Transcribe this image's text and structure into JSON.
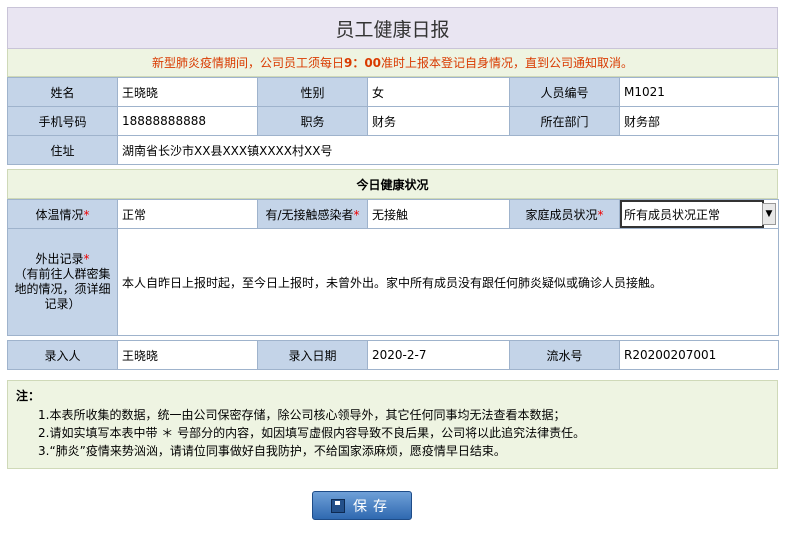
{
  "title": "员工健康日报",
  "notice": {
    "before": "新型肺炎疫情期间，公司员工须每日",
    "time": "9：00",
    "after": "准时上报本登记自身情况，直到公司通知取消。"
  },
  "basic": {
    "name_label": "姓名",
    "name": "王晓晓",
    "gender_label": "性别",
    "gender": "女",
    "empno_label": "人员编号",
    "empno": "M1021",
    "phone_label": "手机号码",
    "phone": "18888888888",
    "position_label": "职务",
    "position": "财务",
    "dept_label": "所在部门",
    "dept": "财务部",
    "address_label": "住址",
    "address": "湖南省长沙市XX县XXX镇XXXX村XX号"
  },
  "health": {
    "section_title": "今日健康状况",
    "temp_label": "体温情况",
    "temp": "正常",
    "contact_label": "有/无接触感染者",
    "contact": "无接触",
    "family_label": "家庭成员状况",
    "family": "所有成员状况正常",
    "outing_label": "外出记录",
    "outing_hint": "（有前往人群密集地的情况，须详细记录）",
    "outing": "本人自昨日上报时起，至今日上报时，未曾外出。家中所有成员没有跟任何肺炎疑似或确诊人员接触。"
  },
  "record": {
    "entry_label": "录入人",
    "entry": "王晓晓",
    "date_label": "录入日期",
    "date": "2020-2-7",
    "serial_label": "流水号",
    "serial": "R20200207001"
  },
  "notes": {
    "heading": "注：",
    "items": [
      "1.本表所收集的数据，统一由公司保密存储，除公司核心领导外，其它任何同事均无法查看本数据；",
      "2.请如实填写本表中带 ＊ 号部分的内容，如因填写虚假内容导致不良后果，公司将以此追究法律责任。",
      "3.“肺炎”疫情来势汹汹，请请位同事做好自我防护，不给国家添麻烦，愿疫情早日结束。"
    ]
  },
  "required_mark": "*",
  "save_label": "保存",
  "colors": {
    "label_bg": "#c4d4e8",
    "section_bg": "#eef4e2",
    "notice_text": "#d93a00",
    "button": "#2f69b0",
    "date_bg": "#ccffcc"
  }
}
